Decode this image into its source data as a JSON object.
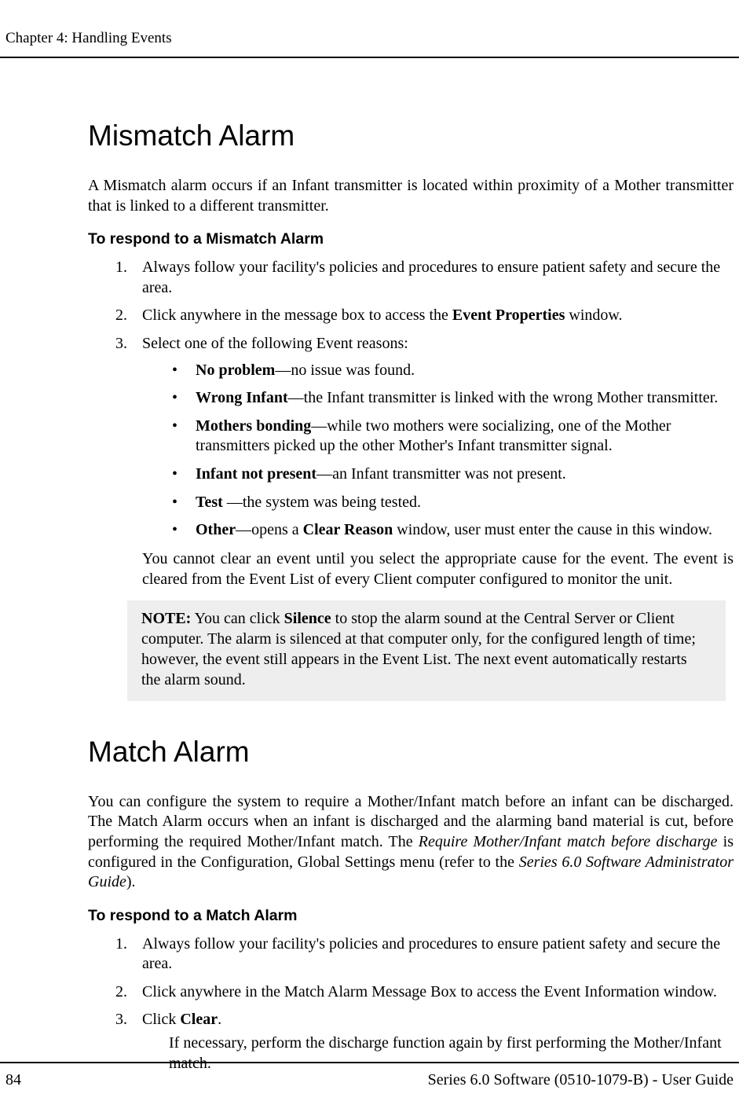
{
  "header": {
    "chapter": "Chapter 4: Handling Events"
  },
  "sections": {
    "mismatch": {
      "title": "Mismatch Alarm",
      "intro": "A Mismatch alarm occurs if an Infant transmitter is located within proximity of a Mother transmitter that is linked to a different transmitter.",
      "respond_heading": "To respond to a Mismatch Alarm",
      "steps": {
        "s1": "Always follow your facility's policies and procedures to ensure patient safety and secure the area.",
        "s2_pre": "Click anywhere in the message box to access the ",
        "s2_bold": "Event Properties",
        "s2_post": " window.",
        "s3": "Select one of the following Event reasons:"
      },
      "reasons": {
        "r1_b": "No problem",
        "r1_t": "—no issue was found.",
        "r2_b": "Wrong Infant",
        "r2_t": "—the Infant transmitter is linked with the wrong Mother transmitter.",
        "r3_b": "Mothers bonding",
        "r3_t": "—while two mothers were socializing, one of the Mother transmitters picked up the other Mother's Infant transmitter signal.",
        "r4_b": "Infant not present",
        "r4_t": "—an Infant transmitter was not present.",
        "r5_b": "Test ",
        "r5_t": "—the system was being tested.",
        "r6_b": "Other",
        "r6_mid": "—opens a ",
        "r6_b2": "Clear Reason",
        "r6_t": " window, user must enter the cause in this window."
      },
      "trail": "You cannot clear an event until you select the appropriate cause for the event. The event is cleared from the Event List of every Client computer configured to monitor the unit.",
      "note_label": "NOTE:",
      "note_pre": " You can click ",
      "note_bold": "Silence",
      "note_post": " to stop the alarm sound at the Central Server or Client computer. The alarm is silenced at that computer only, for the configured length of time; however, the event still appears in the Event List. The next event automatically restarts the alarm sound."
    },
    "match": {
      "title": "Match Alarm",
      "intro_pre": "You can configure the system to require a Mother/Infant match before an infant can be discharged. The Match Alarm occurs when an infant is discharged and the alarming band material is cut, before performing the required Mother/Infant match. The ",
      "intro_i1": "Require Mother/Infant match before discharge",
      "intro_mid": " is configured in the Configuration, Global Settings menu (refer to the ",
      "intro_i2": "Series 6.0 Software Administrator Guide",
      "intro_post": ").",
      "respond_heading": "To respond to a Match Alarm",
      "steps": {
        "s1": "Always follow your facility's policies and procedures to ensure patient safety and secure the area.",
        "s2": "Click anywhere in the Match Alarm Message Box to access the Event Information window.",
        "s3_pre": "Click ",
        "s3_bold": "Clear",
        "s3_post": ".",
        "s3_sub": "If necessary, perform the discharge function again by first performing the Mother/Infant match."
      }
    }
  },
  "footer": {
    "page_number": "84",
    "doc_title": "Series 6.0 Software (0510-1079-B) - User Guide"
  }
}
